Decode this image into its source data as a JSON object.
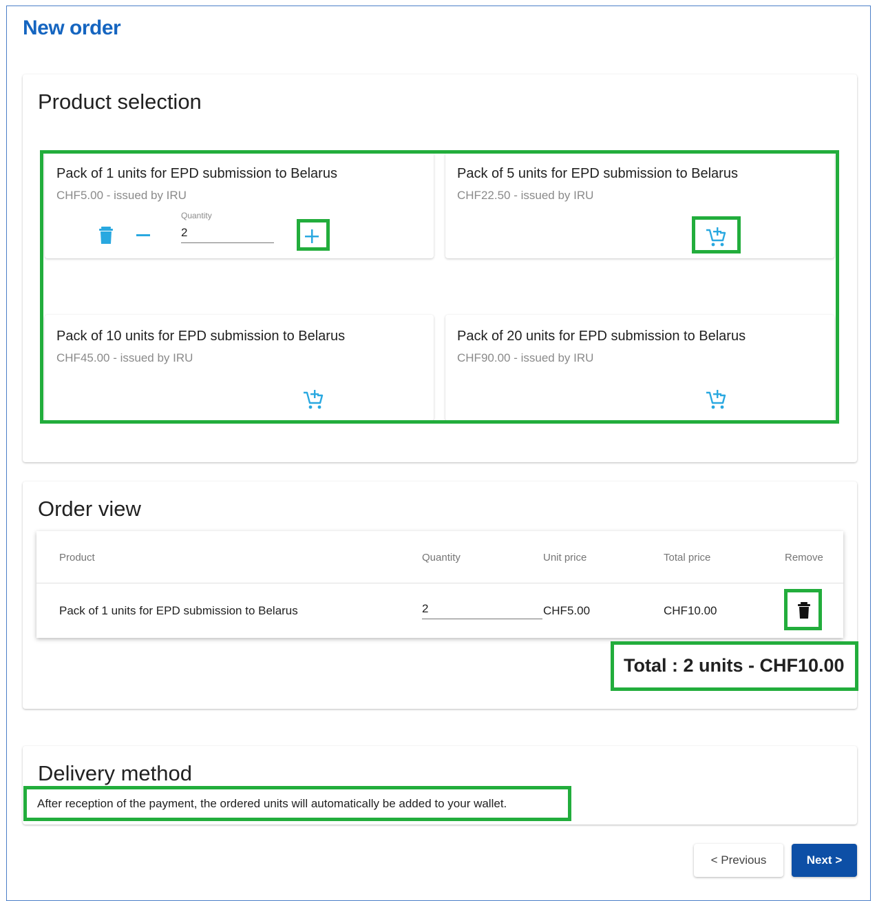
{
  "page": {
    "title": "New order"
  },
  "colors": {
    "accent": "#1565c0",
    "icon_blue": "#29a8e0",
    "highlight": "#22ad3c",
    "primary_button": "#0d4fa6"
  },
  "product_selection": {
    "title": "Product selection",
    "quantity_label": "Quantity",
    "products": [
      {
        "name": "Pack of 1 units for EPD submission to Belarus",
        "price": "CHF5.00 - issued by IRU",
        "quantity": "2",
        "in_cart": true
      },
      {
        "name": "Pack of 5 units for EPD submission to Belarus",
        "price": "CHF22.50 - issued by IRU",
        "in_cart": false
      },
      {
        "name": "Pack of 10 units for EPD submission to Belarus",
        "price": "CHF45.00 - issued by IRU",
        "in_cart": false
      },
      {
        "name": "Pack of 20 units for EPD submission to Belarus",
        "price": "CHF90.00 - issued by IRU",
        "in_cart": false
      }
    ],
    "icons": {
      "delete": "trash-icon",
      "decrease": "minus-icon",
      "increase": "plus-icon",
      "add": "add-to-cart-icon"
    }
  },
  "order_view": {
    "title": "Order view",
    "columns": [
      "Product",
      "Quantity",
      "Unit price",
      "Total price",
      "Remove"
    ],
    "rows": [
      {
        "product": "Pack of 1 units for EPD submission to Belarus",
        "quantity": "2",
        "unit_price": "CHF5.00",
        "total_price": "CHF10.00"
      }
    ],
    "total": "Total : 2 units - CHF10.00"
  },
  "delivery": {
    "title": "Delivery method",
    "text": "After reception of the payment, the ordered units will automatically be added to your wallet."
  },
  "nav": {
    "previous": "< Previous",
    "next": "Next >"
  }
}
